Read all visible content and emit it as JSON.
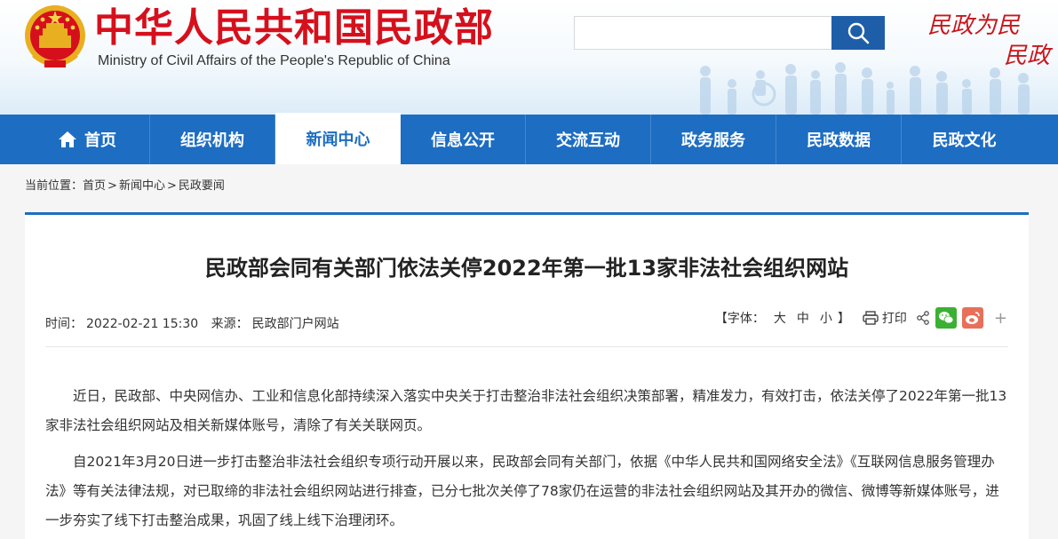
{
  "header": {
    "title": "中华人民共和国民政部",
    "subtitle": "Ministry of Civil Affairs of the People's Republic of China",
    "search_placeholder": "",
    "slogan_line1": "民政为民",
    "slogan_line2": "民政"
  },
  "nav": {
    "items": [
      {
        "label": "首页",
        "icon": "home-icon"
      },
      {
        "label": "组织机构"
      },
      {
        "label": "新闻中心",
        "active": true
      },
      {
        "label": "信息公开"
      },
      {
        "label": "交流互动"
      },
      {
        "label": "政务服务"
      },
      {
        "label": "民政数据"
      },
      {
        "label": "民政文化"
      }
    ]
  },
  "breadcrumb": {
    "prefix": "当前位置：",
    "items": [
      "首页",
      "新闻中心",
      "民政要闻"
    ],
    "sep": ">"
  },
  "article": {
    "title": "民政部会同有关部门依法关停2022年第一批13家非法社会组织网站",
    "time_label": "时间：",
    "time": "2022-02-21 15:30",
    "source_label": "来源：",
    "source": "民政部门户网站",
    "font_label": "【字体：",
    "font_large": "大",
    "font_medium": "中",
    "font_small": "小",
    "font_end": "】",
    "print_label": "打印",
    "paragraphs": [
      "近日，民政部、中央网信办、工业和信息化部持续深入落实中央关于打击整治非法社会组织决策部署，精准发力，有效打击，依法关停了2022年第一批13家非法社会组织网站及相关新媒体账号，清除了有关关联网页。",
      "自2021年3月20日进一步打击整治非法社会组织专项行动开展以来，民政部会同有关部门，依据《中华人民共和国网络安全法》《互联网信息服务管理办法》等有关法律法规，对已取缔的非法社会组织网站进行排查，已分七批次关停了78家仍在运营的非法社会组织网站及其开办的微信、微博等新媒体账号，进一步夯实了线下打击整治成果，巩固了线上线下治理闭环。"
    ]
  },
  "colors": {
    "brand_red": "#d5101c",
    "nav_blue": "#1d6dc2",
    "search_blue": "#1e5ea9"
  }
}
